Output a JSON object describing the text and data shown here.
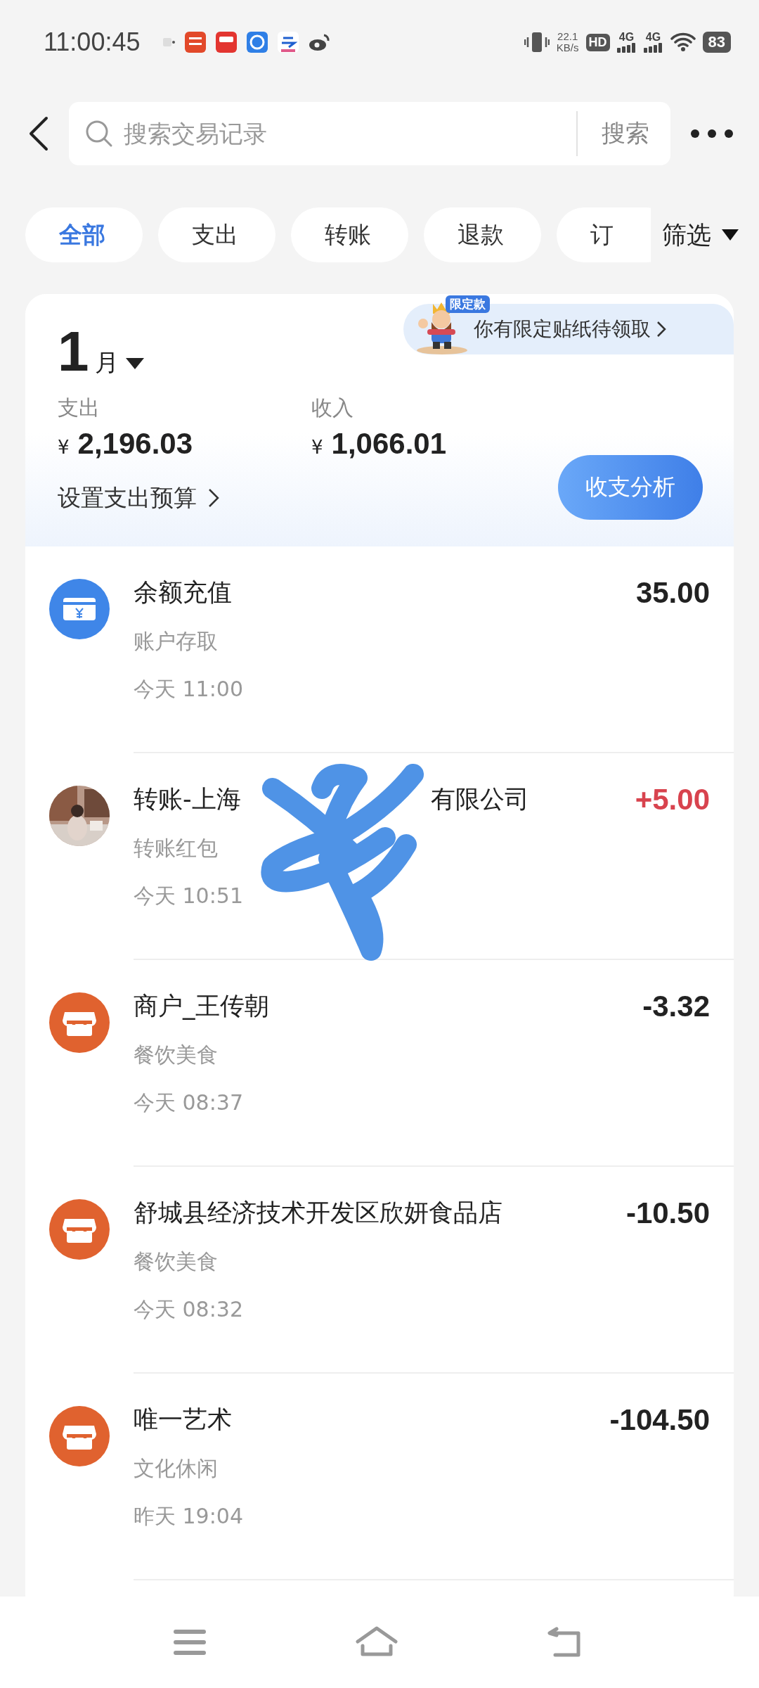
{
  "status_bar": {
    "time": "11:00:45",
    "speed_value": "22.1",
    "speed_unit": "KB/s",
    "hd": "HD",
    "networks": [
      "4G",
      "4G"
    ],
    "battery": "83"
  },
  "search": {
    "placeholder": "搜索交易记录",
    "button": "搜索"
  },
  "filters": [
    {
      "label": "全部",
      "selected": true
    },
    {
      "label": "支出",
      "selected": false
    },
    {
      "label": "转账",
      "selected": false
    },
    {
      "label": "退款",
      "selected": false
    },
    {
      "label": "订",
      "selected": false
    }
  ],
  "filter_button": "筛选",
  "summary": {
    "month_number": "1",
    "month_unit": "月",
    "promo": {
      "tag": "限定款",
      "text": "你有限定贴纸待领取"
    },
    "expense": {
      "label": "支出",
      "currency": "¥",
      "amount": "2,196.03"
    },
    "income": {
      "label": "收入",
      "currency": "¥",
      "amount": "1,066.01"
    },
    "budget_link": "设置支出预算",
    "analysis_button": "收支分析"
  },
  "transactions": [
    {
      "kind": "card",
      "title": "余额充值",
      "category": "账户存取",
      "time": "今天 11:00",
      "amount": "35.00",
      "income": false
    },
    {
      "title_parts": [
        "转账-上海",
        "有限公司"
      ],
      "category": "转账红包",
      "time": "今天 10:51",
      "amount": "+5.00",
      "income": true
    },
    {
      "kind": "shop",
      "title": "商户_王传朝",
      "category": "餐饮美食",
      "time": "今天 08:37",
      "amount": "-3.32",
      "income": false
    },
    {
      "kind": "shop",
      "title": "舒城县经济技术开发区欣妍食品店",
      "category": "餐饮美食",
      "time": "今天 08:32",
      "amount": "-10.50",
      "income": false
    },
    {
      "kind": "shop",
      "title": "唯一艺术",
      "category": "文化休闲",
      "time": "昨天 19:04",
      "amount": "-104.50",
      "income": false
    }
  ]
}
